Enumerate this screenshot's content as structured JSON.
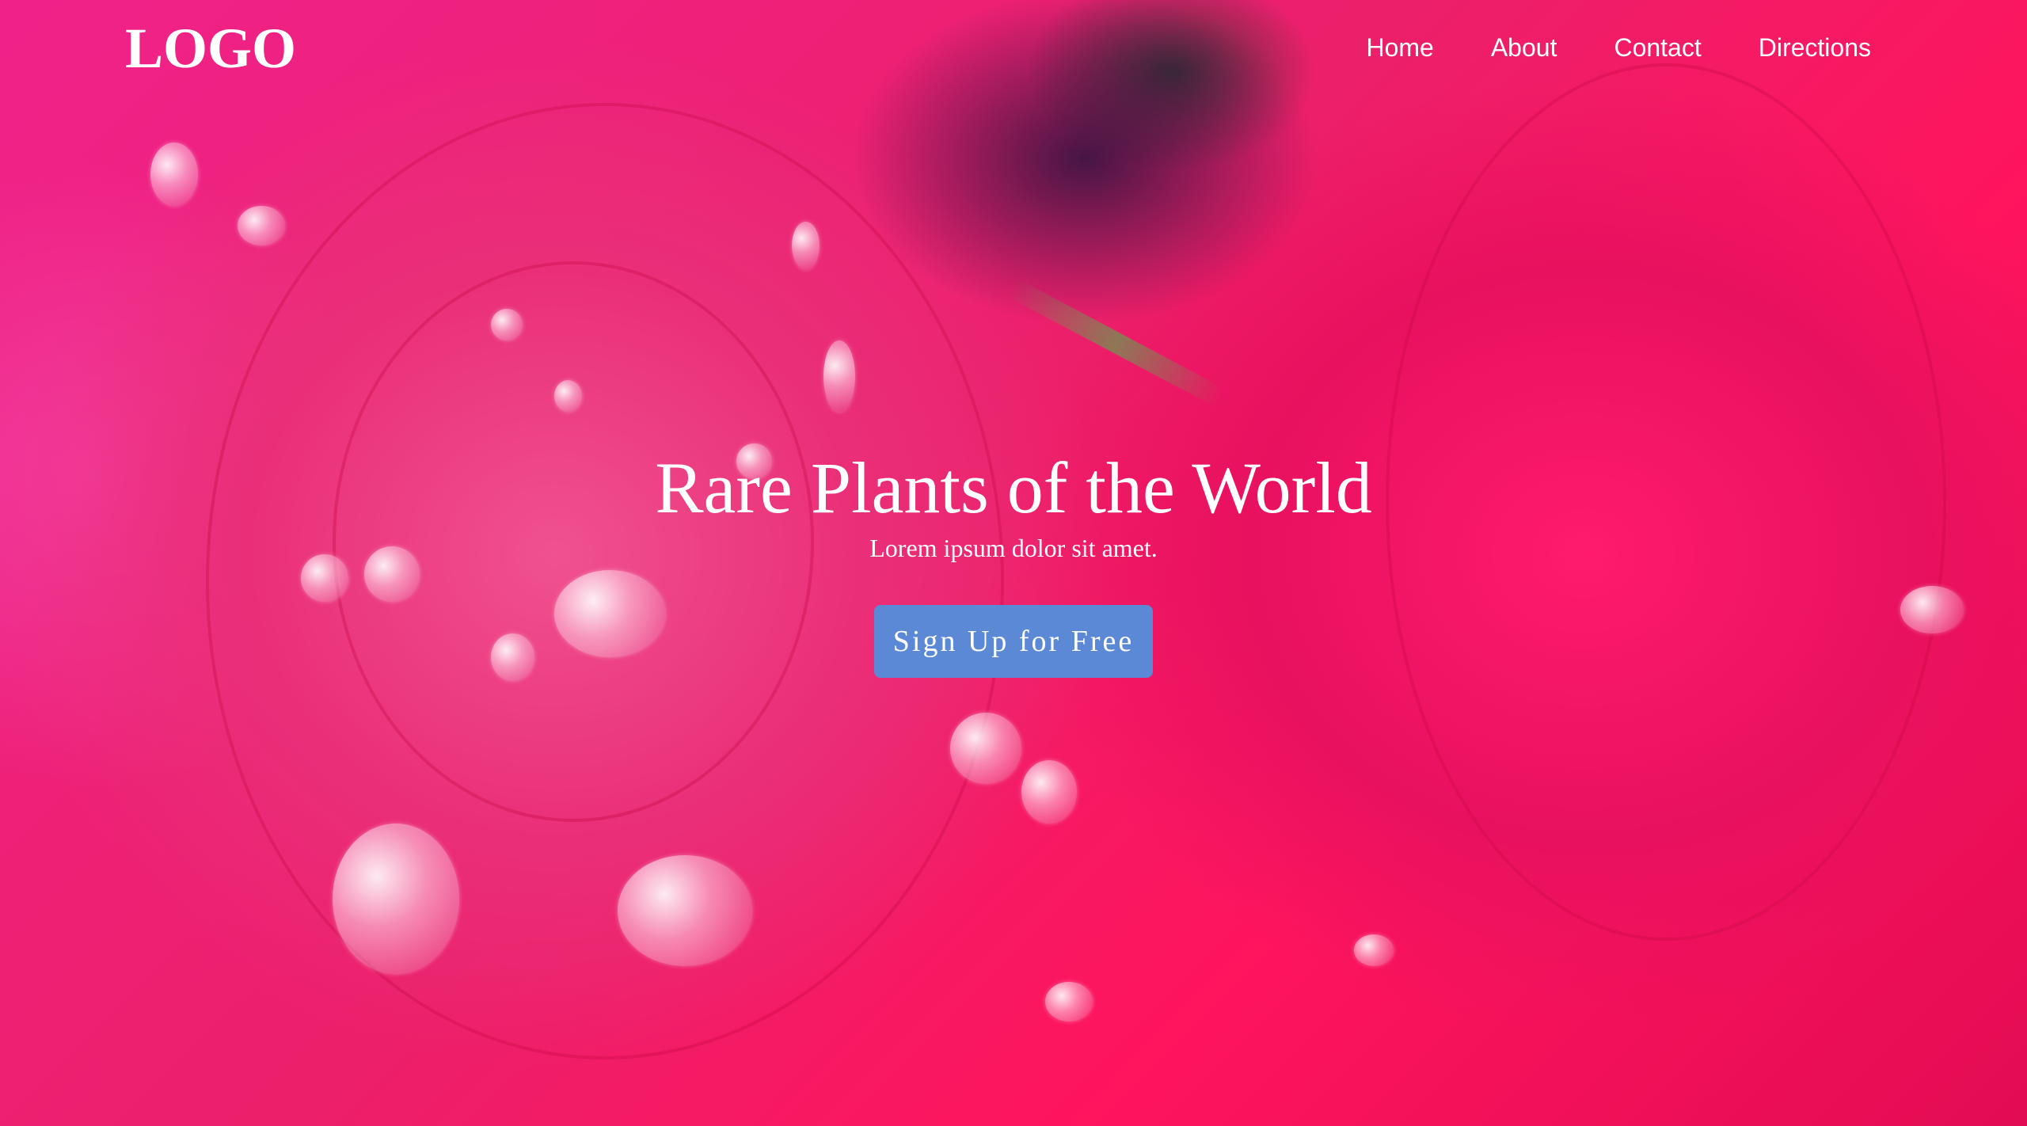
{
  "header": {
    "logo": "LOGO",
    "nav": [
      {
        "label": "Home"
      },
      {
        "label": "About"
      },
      {
        "label": "Contact"
      },
      {
        "label": "Directions"
      }
    ]
  },
  "hero": {
    "title": "Rare Plants of the World",
    "subtitle": "Lorem ipsum dolor sit amet.",
    "cta_label": "Sign Up for Free",
    "background": {
      "description_icon": "flower-petals-image",
      "accent_colors": [
        "#ea2f78",
        "#ff1a6e",
        "#f0228a"
      ]
    }
  },
  "colors": {
    "button": "#5b89d6",
    "text": "#ffffff"
  }
}
